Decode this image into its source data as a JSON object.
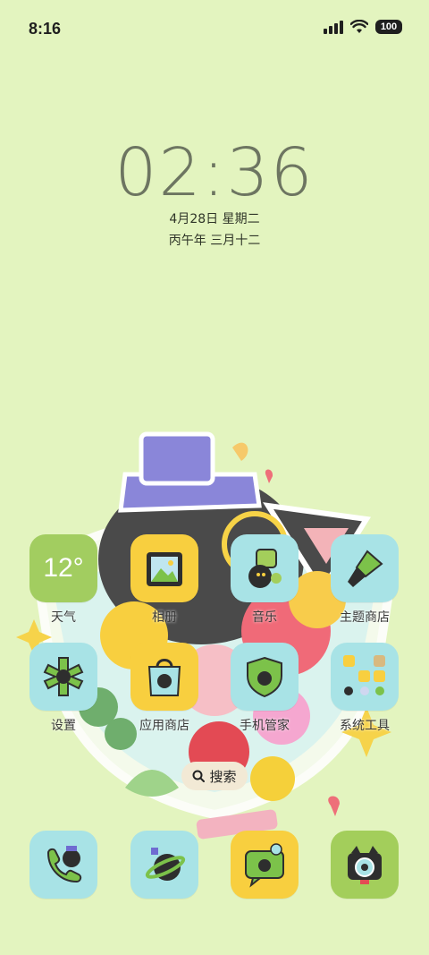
{
  "status_bar": {
    "time": "8:16",
    "battery": "100"
  },
  "lock": {
    "time": "02:36",
    "date": "4月28日 星期二",
    "lunar": "丙午年 三月十二"
  },
  "apps_row1": [
    {
      "label": "天气",
      "temp": "12°",
      "icon": "weather-icon"
    },
    {
      "label": "相册",
      "icon": "gallery-icon"
    },
    {
      "label": "音乐",
      "icon": "music-icon"
    },
    {
      "label": "主题商店",
      "icon": "theme-store-icon"
    }
  ],
  "apps_row2": [
    {
      "label": "设置",
      "icon": "settings-icon"
    },
    {
      "label": "应用商店",
      "icon": "app-store-icon"
    },
    {
      "label": "手机管家",
      "icon": "security-icon"
    },
    {
      "label": "系统工具",
      "icon": "system-tools-folder-icon"
    }
  ],
  "search": {
    "label": "搜索"
  },
  "dock": [
    {
      "icon": "phone-icon"
    },
    {
      "icon": "browser-icon"
    },
    {
      "icon": "messages-icon"
    },
    {
      "icon": "camera-icon"
    }
  ],
  "colors": {
    "background": "#e3f4bf",
    "tile_blue": "#a8e3e6",
    "tile_yellow": "#f8cf3f",
    "tile_green": "#a3ce5b"
  }
}
